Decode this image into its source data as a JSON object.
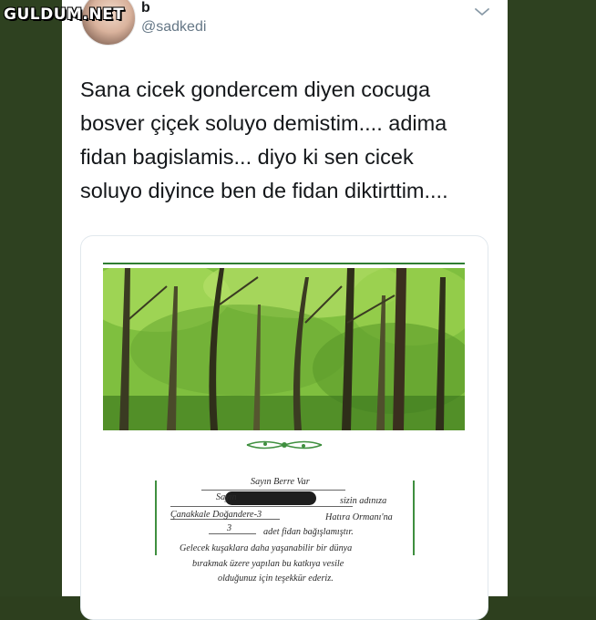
{
  "watermark": "GULDUM.NET",
  "tweet": {
    "display_name": "b",
    "handle": "@sadkedi",
    "text_lines": [
      "Sana cicek gondercem diyen cocuga",
      "bosver çiçek soluyo demistim.... adima",
      "fidan bagislamis... diyo ki sen cicek",
      "soluyo diyince ben de fidan diktirttim...."
    ]
  },
  "icons": {
    "menu": "chevron-down-icon",
    "avatar": "profile-photo",
    "ornament": "leaf-ornament"
  },
  "certificate": {
    "line1": "Sayın Berre Var",
    "line2_prefix": "Sayın",
    "line2_suffix": "sizin adınıza",
    "line3_place": "Çanakkale Doğandere-3",
    "line3_suffix": "Hatıra Ormanı'na",
    "line4_count": "3",
    "line4_suffix": "adet fidan bağışlamıştır.",
    "line5": "Gelecek kuşaklara daha yaşanabilir bir dünya",
    "line6": "bırakmak üzere yapılan bu katkıya vesile",
    "line7": "olduğunuz için teşekkür ederiz."
  },
  "colors": {
    "background": "#2e4120",
    "card": "#ffffff",
    "text": "#14171a",
    "secondary_text": "#657786",
    "certificate_green": "#3f8f3f"
  }
}
